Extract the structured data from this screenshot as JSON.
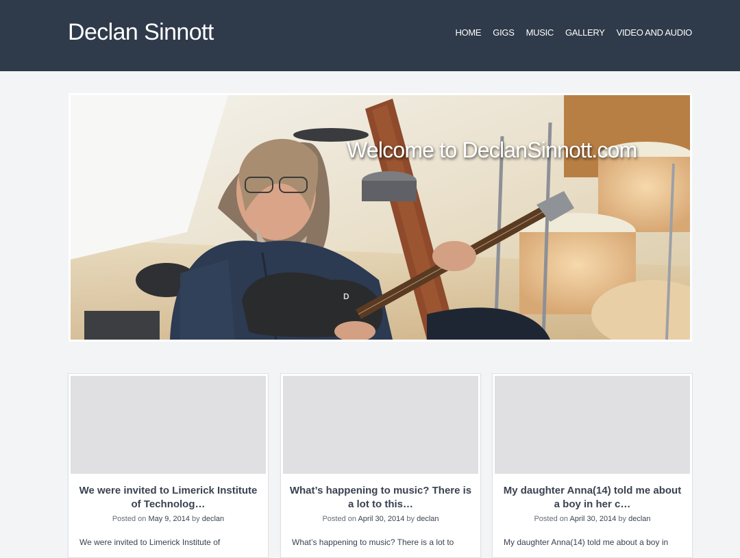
{
  "site": {
    "title": "Declan Sinnott"
  },
  "nav": {
    "items": [
      {
        "label": "HOME"
      },
      {
        "label": "GIGS"
      },
      {
        "label": "MUSIC"
      },
      {
        "label": "GALLERY"
      },
      {
        "label": "VIDEO AND AUDIO"
      }
    ]
  },
  "hero": {
    "title": "Welcome to DeclanSinnott.com"
  },
  "posts": [
    {
      "title": "We were invited to Limerick Institute of Technolog…",
      "posted_on": "Posted on",
      "date": "May 9, 2014",
      "by": "by",
      "author": "declan",
      "excerpt": "We were invited to Limerick Institute of"
    },
    {
      "title": "What’s happening to music? There is a lot to this…",
      "posted_on": "Posted on",
      "date": "April 30, 2014",
      "by": "by",
      "author": "declan",
      "excerpt": "What’s happening to music? There is a lot to"
    },
    {
      "title": "My daughter Anna(14) told me about a boy in her c…",
      "posted_on": "Posted on",
      "date": "April 30, 2014",
      "by": "by",
      "author": "declan",
      "excerpt": "My daughter Anna(14) told me about a boy in"
    }
  ],
  "colors": {
    "header_bg": "#2f3a4a",
    "page_bg": "#f3f4f6",
    "thumb_placeholder": "#e0e0e2"
  }
}
